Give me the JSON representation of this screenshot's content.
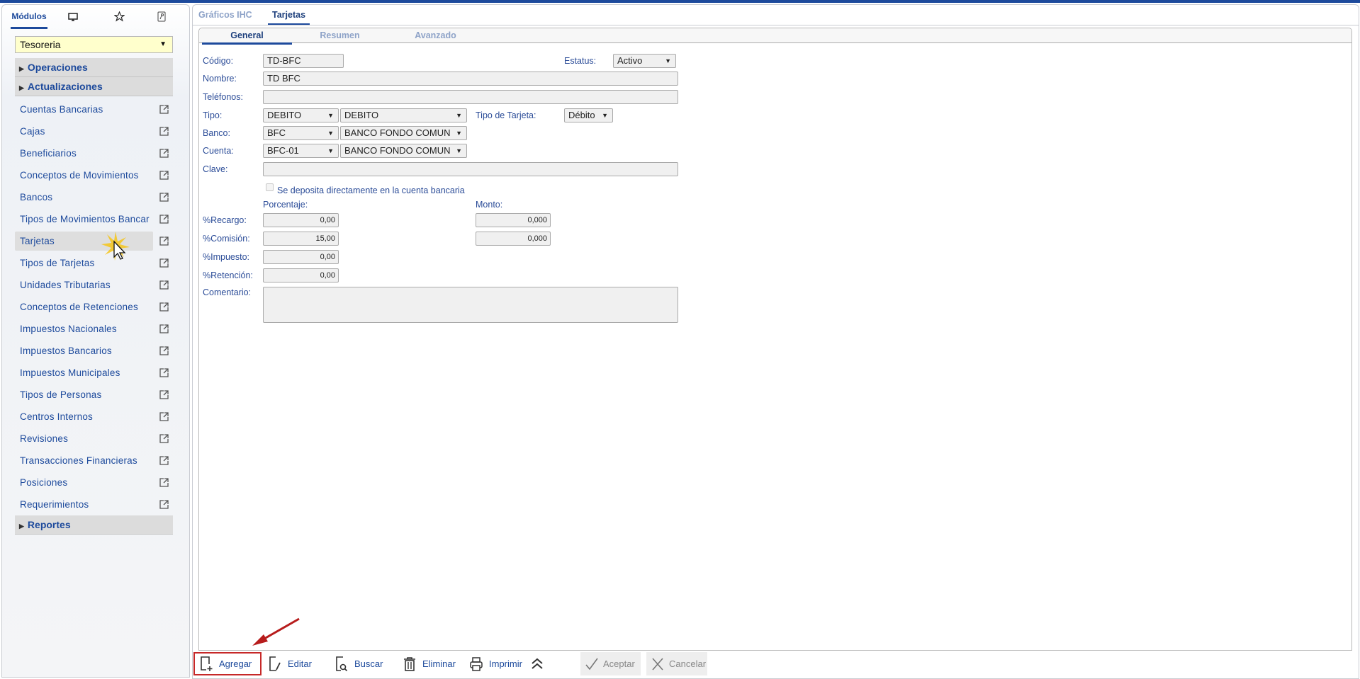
{
  "sidebar": {
    "tabs": [
      {
        "label": "Módulos"
      },
      {
        "icon": "monitor-icon"
      },
      {
        "icon": "star-icon"
      },
      {
        "icon": "key-icon"
      }
    ],
    "module_select": "Tesoreria",
    "groups": {
      "operaciones": "Operaciones",
      "actualizaciones": "Actualizaciones",
      "reportes": "Reportes"
    },
    "items": [
      {
        "label": "Cuentas Bancarias"
      },
      {
        "label": "Cajas"
      },
      {
        "label": "Beneficiarios"
      },
      {
        "label": "Conceptos de Movimientos"
      },
      {
        "label": "Bancos"
      },
      {
        "label": "Tipos de Movimientos Bancar"
      },
      {
        "label": "Tarjetas"
      },
      {
        "label": "Tipos de Tarjetas"
      },
      {
        "label": "Unidades Tributarias"
      },
      {
        "label": "Conceptos de Retenciones"
      },
      {
        "label": "Impuestos Nacionales"
      },
      {
        "label": "Impuestos Bancarios"
      },
      {
        "label": "Impuestos Municipales"
      },
      {
        "label": "Tipos de Personas"
      },
      {
        "label": "Centros Internos"
      },
      {
        "label": "Revisiones"
      },
      {
        "label": "Transacciones Financieras"
      },
      {
        "label": "Posiciones"
      },
      {
        "label": "Requerimientos"
      }
    ],
    "selected_item": "Tarjetas"
  },
  "main": {
    "tabs": [
      "Gráficos IHC",
      "Tarjetas"
    ],
    "subtabs": [
      "General",
      "Resumen",
      "Avanzado"
    ],
    "form": {
      "codigo": {
        "label": "Código:",
        "value": "TD-BFC"
      },
      "estatus": {
        "label": "Estatus:",
        "value": "Activo"
      },
      "nombre": {
        "label": "Nombre:",
        "value": "TD BFC"
      },
      "telefonos": {
        "label": "Teléfonos:",
        "value": ""
      },
      "tipo": {
        "label": "Tipo:",
        "code": "DEBITO",
        "name": "DEBITO"
      },
      "tipo_tarjeta": {
        "label": "Tipo de Tarjeta:",
        "value": "Débito"
      },
      "banco": {
        "label": "Banco:",
        "code": "BFC",
        "name": "BANCO FONDO COMUN"
      },
      "cuenta": {
        "label": "Cuenta:",
        "code": "BFC-01",
        "name": "BANCO FONDO COMUN"
      },
      "clave": {
        "label": "Clave:",
        "value": ""
      },
      "deposito": {
        "label": "Se deposita directamente en la cuenta bancaria",
        "checked": false
      },
      "porcentaje_header": "Porcentaje:",
      "monto_header": "Monto:",
      "recargo": {
        "label": "%Recargo:",
        "pct": "0,00",
        "monto": "0,000"
      },
      "comision": {
        "label": "%Comisión:",
        "pct": "15,00",
        "monto": "0,000"
      },
      "impuesto": {
        "label": "%Impuesto:",
        "pct": "0,00"
      },
      "retencion": {
        "label": "%Retención:",
        "pct": "0,00"
      },
      "comentario": {
        "label": "Comentario:",
        "value": ""
      }
    }
  },
  "toolbar": {
    "agregar": "Agregar",
    "editar": "Editar",
    "buscar": "Buscar",
    "eliminar": "Eliminar",
    "imprimir": "Imprimir",
    "aceptar": "Aceptar",
    "cancelar": "Cancelar"
  },
  "colors": {
    "accent": "#1d4a9c",
    "highlight_box": "#c62828",
    "module_select_bg": "#ffffcc"
  }
}
